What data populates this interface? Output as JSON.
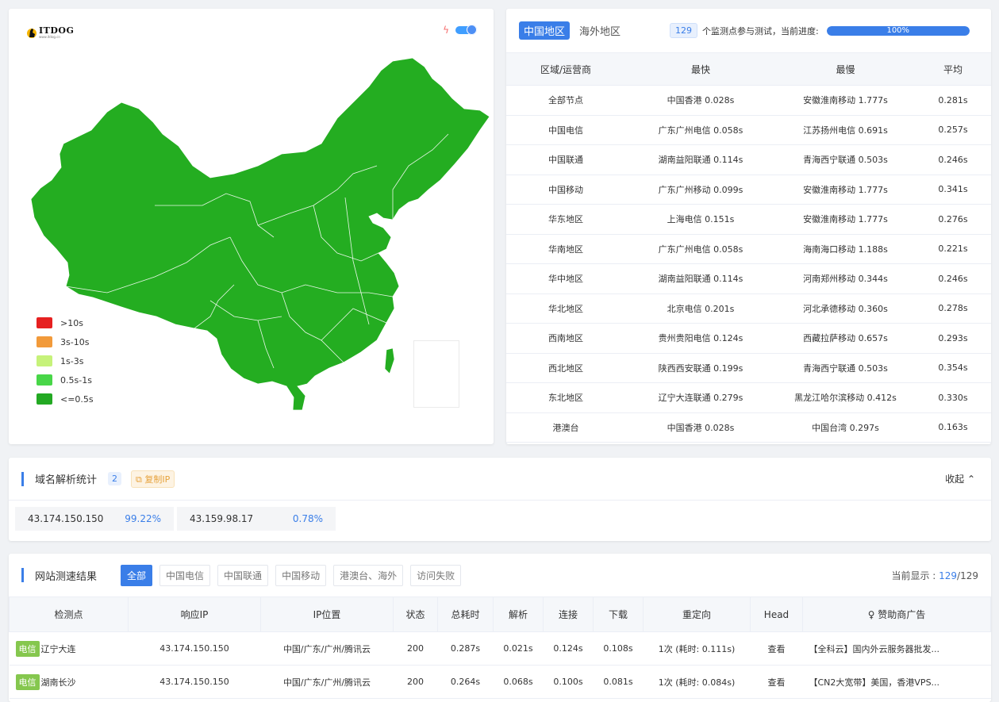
{
  "map": {
    "brand": "ITDOG",
    "brand_sub": "www.itdog.cn",
    "legend": [
      {
        "label": ">10s",
        "color": "#e62020"
      },
      {
        "label": "3s-10s",
        "color": "#f29a3a"
      },
      {
        "label": "1s-3s",
        "color": "#c6f27a"
      },
      {
        "label": "0.5s-1s",
        "color": "#48d648"
      },
      {
        "label": "<=0.5s",
        "color": "#23a923"
      }
    ],
    "fill_color": "#24ad21"
  },
  "results": {
    "tabs": [
      "中国地区",
      "海外地区"
    ],
    "count": "129",
    "count_text": "个监测点参与测试，当前进度:",
    "progress": 100,
    "progress_label": "100%",
    "headers": [
      "区域/运营商",
      "最快",
      "最慢",
      "平均"
    ],
    "rows": [
      [
        "全部节点",
        "中国香港 0.028s",
        "安徽淮南移动 1.777s",
        "0.281s"
      ],
      [
        "中国电信",
        "广东广州电信 0.058s",
        "江苏扬州电信 0.691s",
        "0.257s"
      ],
      [
        "中国联通",
        "湖南益阳联通 0.114s",
        "青海西宁联通 0.503s",
        "0.246s"
      ],
      [
        "中国移动",
        "广东广州移动 0.099s",
        "安徽淮南移动 1.777s",
        "0.341s"
      ],
      [
        "华东地区",
        "上海电信 0.151s",
        "安徽淮南移动 1.777s",
        "0.276s"
      ],
      [
        "华南地区",
        "广东广州电信 0.058s",
        "海南海口移动 1.188s",
        "0.221s"
      ],
      [
        "华中地区",
        "湖南益阳联通 0.114s",
        "河南郑州移动 0.344s",
        "0.246s"
      ],
      [
        "华北地区",
        "北京电信 0.201s",
        "河北承德移动 0.360s",
        "0.278s"
      ],
      [
        "西南地区",
        "贵州贵阳电信 0.124s",
        "西藏拉萨移动 0.657s",
        "0.293s"
      ],
      [
        "西北地区",
        "陕西西安联通 0.199s",
        "青海西宁联通 0.503s",
        "0.354s"
      ],
      [
        "东北地区",
        "辽宁大连联通 0.279s",
        "黑龙江哈尔滨移动 0.412s",
        "0.330s"
      ],
      [
        "港澳台",
        "中国香港 0.028s",
        "中国台湾 0.297s",
        "0.163s"
      ]
    ]
  },
  "dns": {
    "title": "域名解析统计",
    "count": "2",
    "copy_label": "复制IP",
    "collapse_label": "收起 ⌃",
    "items": [
      {
        "ip": "43.174.150.150",
        "pct": "99.22%"
      },
      {
        "ip": "43.159.98.17",
        "pct": "0.78%"
      }
    ]
  },
  "speed": {
    "title": "网站测速结果",
    "filters": [
      "全部",
      "中国电信",
      "中国联通",
      "中国移动",
      "港澳台、海外",
      "访问失败"
    ],
    "shown_label": "当前显示 : ",
    "shown_a": "129",
    "shown_sep": "/",
    "shown_b": "129",
    "headers": [
      "检测点",
      "响应IP",
      "IP位置",
      "状态",
      "总耗时",
      "解析",
      "连接",
      "下载",
      "重定向",
      "Head",
      "♀ 赞助商广告"
    ],
    "rows": [
      {
        "isp": "电信",
        "node": "辽宁大连",
        "ip": "43.174.150.150",
        "loc": "中国/广东/广州/腾讯云",
        "status": "200",
        "total": "0.287s",
        "dns": "0.021s",
        "connect": "0.124s",
        "download": "0.108s",
        "redirect": "1次 (耗时: 0.111s)",
        "head": "查看",
        "ad": "【全科云】国内外云服务器批发..."
      },
      {
        "isp": "电信",
        "node": "湖南长沙",
        "ip": "43.174.150.150",
        "loc": "中国/广东/广州/腾讯云",
        "status": "200",
        "total": "0.264s",
        "dns": "0.068s",
        "connect": "0.100s",
        "download": "0.081s",
        "redirect": "1次 (耗时: 0.084s)",
        "head": "查看",
        "ad": "【CN2大宽带】美国，香港VPS..."
      }
    ]
  }
}
